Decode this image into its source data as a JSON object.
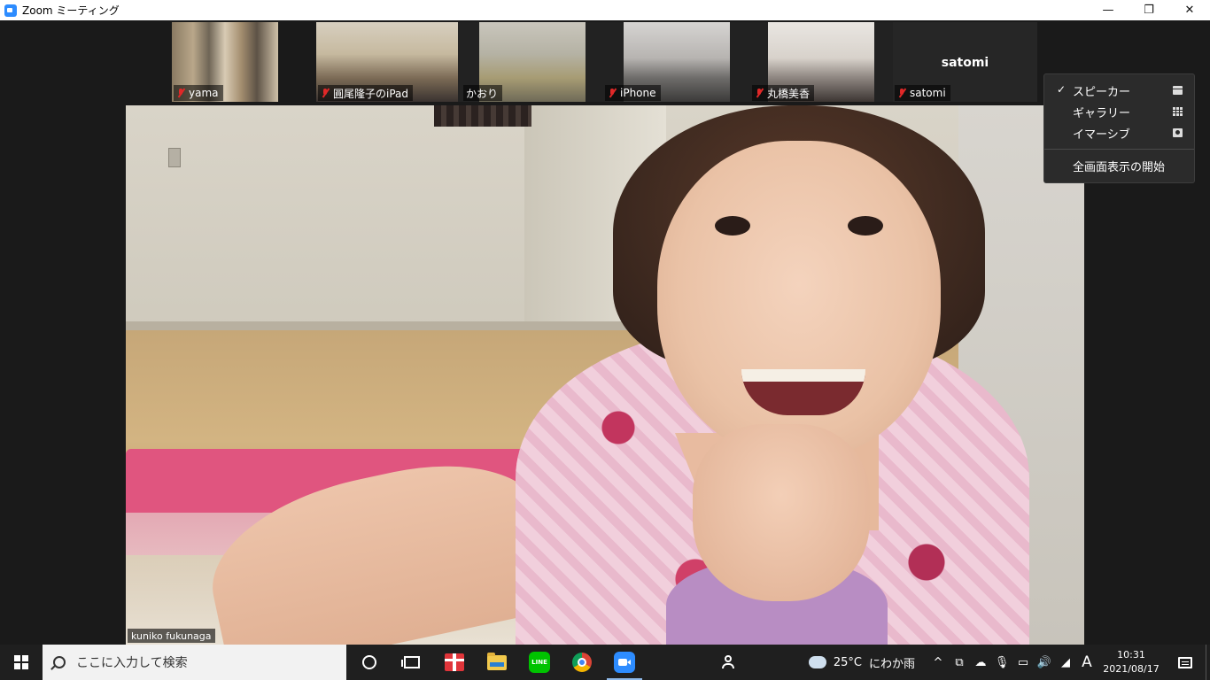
{
  "window": {
    "title": "Zoom ミーティング",
    "controls": {
      "minimize": "—",
      "maximize": "❐",
      "close": "✕"
    }
  },
  "participants": [
    {
      "name": "yama",
      "muted": true
    },
    {
      "name": "圓尾隆子のiPad",
      "muted": true
    },
    {
      "name": "かおり",
      "muted": false
    },
    {
      "name": "iPhone",
      "muted": true
    },
    {
      "name": "丸橋美香",
      "muted": true
    },
    {
      "name": "satomi",
      "muted": true,
      "video_off": true,
      "center_name": "satomi"
    }
  ],
  "active_speaker": {
    "name": "kuniko fukunaga"
  },
  "view_menu": {
    "items": [
      {
        "label": "スピーカー",
        "checked": true,
        "icon": "speaker-view-icon"
      },
      {
        "label": "ギャラリー",
        "checked": false,
        "icon": "gallery-view-icon"
      },
      {
        "label": "イマーシブ",
        "checked": false,
        "icon": "immersive-view-icon"
      }
    ],
    "fullscreen_label": "全画面表示の開始"
  },
  "taskbar": {
    "search_placeholder": "ここに入力して検索",
    "apps": [
      "cortana-icon",
      "task-view-icon",
      "gift-icon",
      "file-explorer-icon",
      "line-icon",
      "chrome-icon",
      "zoom-icon",
      "people-icon"
    ],
    "weather": {
      "temp": "25°C",
      "condition": "にわか雨"
    },
    "tray": {
      "chevron": "^",
      "ime": "A"
    },
    "clock": {
      "time": "10:31",
      "date": "2021/08/17"
    }
  },
  "colors": {
    "zoom_blue": "#2d8cff",
    "mute_red": "#e02828",
    "stage_bg": "#1a1a1a",
    "menu_bg": "#2b2b2b"
  }
}
